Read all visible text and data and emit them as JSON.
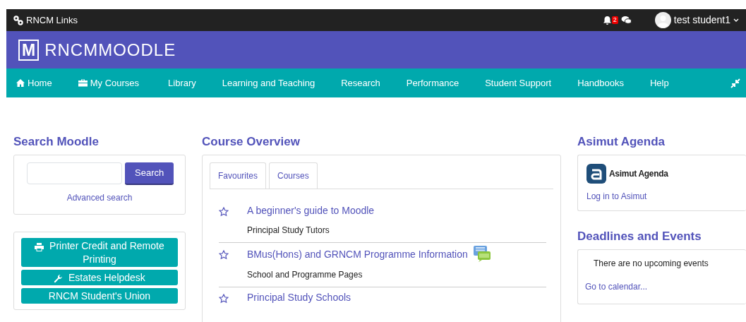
{
  "top_bar": {
    "links_label": "RNCM Links",
    "notification_count": "2",
    "user_name": "test student1"
  },
  "brand": {
    "mark": "M",
    "text": "RNCM**MOODLE**"
  },
  "nav": [
    {
      "label": "Home",
      "kind": "home"
    },
    {
      "label": "My Courses",
      "kind": "courses"
    },
    {
      "label": "Library"
    },
    {
      "label": "Learning and Teaching"
    },
    {
      "label": "Research"
    },
    {
      "label": "Performance"
    },
    {
      "label": "Student Support"
    },
    {
      "label": "Handbooks"
    },
    {
      "label": "Help"
    }
  ],
  "search_block": {
    "title": "Search Moodle",
    "button": "Search",
    "advanced_link": "Advanced search"
  },
  "link_buttons": [
    {
      "label": "Printer Credit and Remote Printing",
      "kind": "printing"
    },
    {
      "label": "Estates Helpdesk",
      "kind": "helpdesk"
    },
    {
      "label": "RNCM Student's Union"
    }
  ],
  "course_overview": {
    "title": "Course Overview",
    "tabs": [
      {
        "label": "Favourites"
      },
      {
        "label": "Courses"
      }
    ],
    "courses": [
      {
        "name": "A beginner's guide to Moodle",
        "category": "Principal Study Tutors",
        "has_forum": false
      },
      {
        "name": "BMus(Hons) and GRNCM Programme Information",
        "category": "School and Programme Pages",
        "has_forum": true
      },
      {
        "name": "Principal Study Schools",
        "has_forum": false
      }
    ]
  },
  "asimut": {
    "title": "Asimut Agenda",
    "app_name": "Asimut Agenda",
    "login_link": "Log in to Asimut"
  },
  "events": {
    "title": "Deadlines and Events",
    "message": "There are no upcoming events",
    "calendar_link": "Go to calendar..."
  }
}
